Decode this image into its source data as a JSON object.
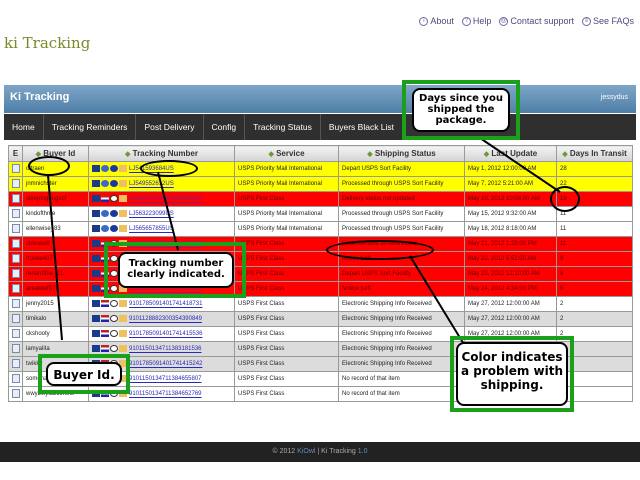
{
  "header": {
    "links": [
      {
        "icon": "info-icon",
        "label": "About"
      },
      {
        "icon": "help-icon",
        "label": "Help"
      },
      {
        "icon": "contact-icon",
        "label": "Contact support"
      },
      {
        "icon": "faq-icon",
        "label": "See FAQs"
      }
    ],
    "logo": "ki Tracking"
  },
  "titlebar": {
    "title": "Ki Tracking",
    "user": "jessydus"
  },
  "nav": [
    "Home",
    "Tracking Reminders",
    "Post Delivery",
    "Config",
    "Tracking Status",
    "Buyers Black List"
  ],
  "table": {
    "columns": [
      "E",
      "Buyer Id",
      "Tracking Number",
      "Service",
      "Shipping Status",
      "Last Update",
      "Days In Transit"
    ],
    "rows": [
      {
        "color": "yellow",
        "icons": "intl",
        "buyer": "oltraen",
        "tracking": "LJ541593684US",
        "service": "USPS Priority Mail International",
        "status": "Depart USPS Sort Facility",
        "updated": "May 1, 2012 12:00:00 AM",
        "days": "28"
      },
      {
        "color": "yellow",
        "icons": "intl",
        "buyer": "jnmnichster",
        "tracking": "LJ549552612US",
        "service": "USPS Priority Mail International",
        "status": "Processed through USPS Sort Facility",
        "updated": "May 7, 2012 5:21:00 AM",
        "days": "22"
      },
      {
        "color": "red",
        "icons": "dom",
        "buyer": "sleepingdogsof",
        "tracking": "9101150922000202883186",
        "service": "USPS First Class",
        "status": "Delivery status not updated",
        "updated": "May 10, 2012 10:06:00 AM",
        "days": "19"
      },
      {
        "color": "white",
        "icons": "intl",
        "buyer": "kindofthme",
        "tracking": "LJ563223099US",
        "service": "USPS Priority Mail International",
        "status": "Processed through USPS Sort Facility",
        "updated": "May 15, 2012 9:32:00 AM",
        "days": "11"
      },
      {
        "color": "white",
        "icons": "intl",
        "buyer": "ellenwise_83",
        "tracking": "LJ565657855US",
        "service": "USPS Priority Mail International",
        "status": "Processed through USPS Sort Facility",
        "updated": "May 18, 2012 8:18:00 AM",
        "days": "11"
      },
      {
        "color": "red",
        "icons": "dom",
        "buyer": "culvuso9",
        "tracking": "9101150922000354108765",
        "service": "USPS First Class",
        "status": "Undeliverable as Addressed",
        "updated": "May 21, 2012 1:28:00 PM",
        "days": "11"
      },
      {
        "color": "red",
        "icons": "dom",
        "buyer": "rtooke407",
        "tracking": "9101150922000354312345",
        "service": "USPS First Class",
        "status": "Notice Left",
        "updated": "May 22, 2012 5:51:00 AM",
        "days": "8"
      },
      {
        "color": "red",
        "icons": "dom",
        "buyer": "renarofine_21",
        "tracking": "9101150922000365432178",
        "service": "USPS First Class",
        "status": "Depart USPS Sort Facility",
        "updated": "May 23, 2012 12:10:00 AM",
        "days": "8"
      },
      {
        "color": "red",
        "icons": "dom",
        "buyer": "areakleif073",
        "tracking": "9101150922000347056608",
        "service": "USPS First Class",
        "status": "Notice Left",
        "updated": "May 24, 2012 4:34:00 PM",
        "days": "6"
      },
      {
        "color": "white",
        "icons": "dom",
        "buyer": "jenny2015",
        "tracking": "9101785091401741418731",
        "service": "USPS First Class",
        "status": "Electronic Shipping Info Received",
        "updated": "May 27, 2012 12:00:00 AM",
        "days": "2"
      },
      {
        "color": "gray",
        "icons": "dom",
        "buyer": "timikalo",
        "tracking": "9101128882300354390849",
        "service": "USPS First Class",
        "status": "Electronic Shipping Info Received",
        "updated": "May 27, 2012 12:00:00 AM",
        "days": "2"
      },
      {
        "color": "white",
        "icons": "dom",
        "buyer": "ckshooty",
        "tracking": "9101785091401741415536",
        "service": "USPS First Class",
        "status": "Electronic Shipping Info Received",
        "updated": "May 27, 2012 12:00:00 AM",
        "days": "2"
      },
      {
        "color": "gray",
        "icons": "dom",
        "buyer": "lamyalita",
        "tracking": "9101150134711383181536",
        "service": "USPS First Class",
        "status": "Electronic Shipping Info Received",
        "updated": "May 27, 2012 12:00:00 AM",
        "days": "2"
      },
      {
        "color": "gray",
        "icons": "dom",
        "buyer": "twikky",
        "tracking": "9101785091401741415242",
        "service": "USPS First Class",
        "status": "Electronic Shipping Info Received",
        "updated": "May 27, 2012 12:00:00 AM",
        "days": "2"
      },
      {
        "color": "white",
        "icons": "dom",
        "buyer": "somenadhikari",
        "tracking": "9101150134711384655807",
        "service": "USPS First Class",
        "status": "No record of that item",
        "updated": "",
        "days": "1"
      },
      {
        "color": "white",
        "icons": "dom",
        "buyer": "wwy2wyld2control",
        "tracking": "9101150134711384652769",
        "service": "USPS First Class",
        "status": "No record of that item",
        "updated": "",
        "days": "0"
      }
    ]
  },
  "footer": {
    "prefix": "© 2012",
    "brand": "KiOwl",
    "product": "Ki Tracking",
    "version": "1.0"
  },
  "annotations": {
    "days": "Days since you shipped the package.",
    "tracking": "Tracking number clearly indicated.",
    "color": "Color indicates a problem with shipping.",
    "buyer": "Buyer Id."
  },
  "colors": {
    "problem": "#ff0000",
    "warning": "#ffff00",
    "callout_border": "#1aa01a"
  }
}
